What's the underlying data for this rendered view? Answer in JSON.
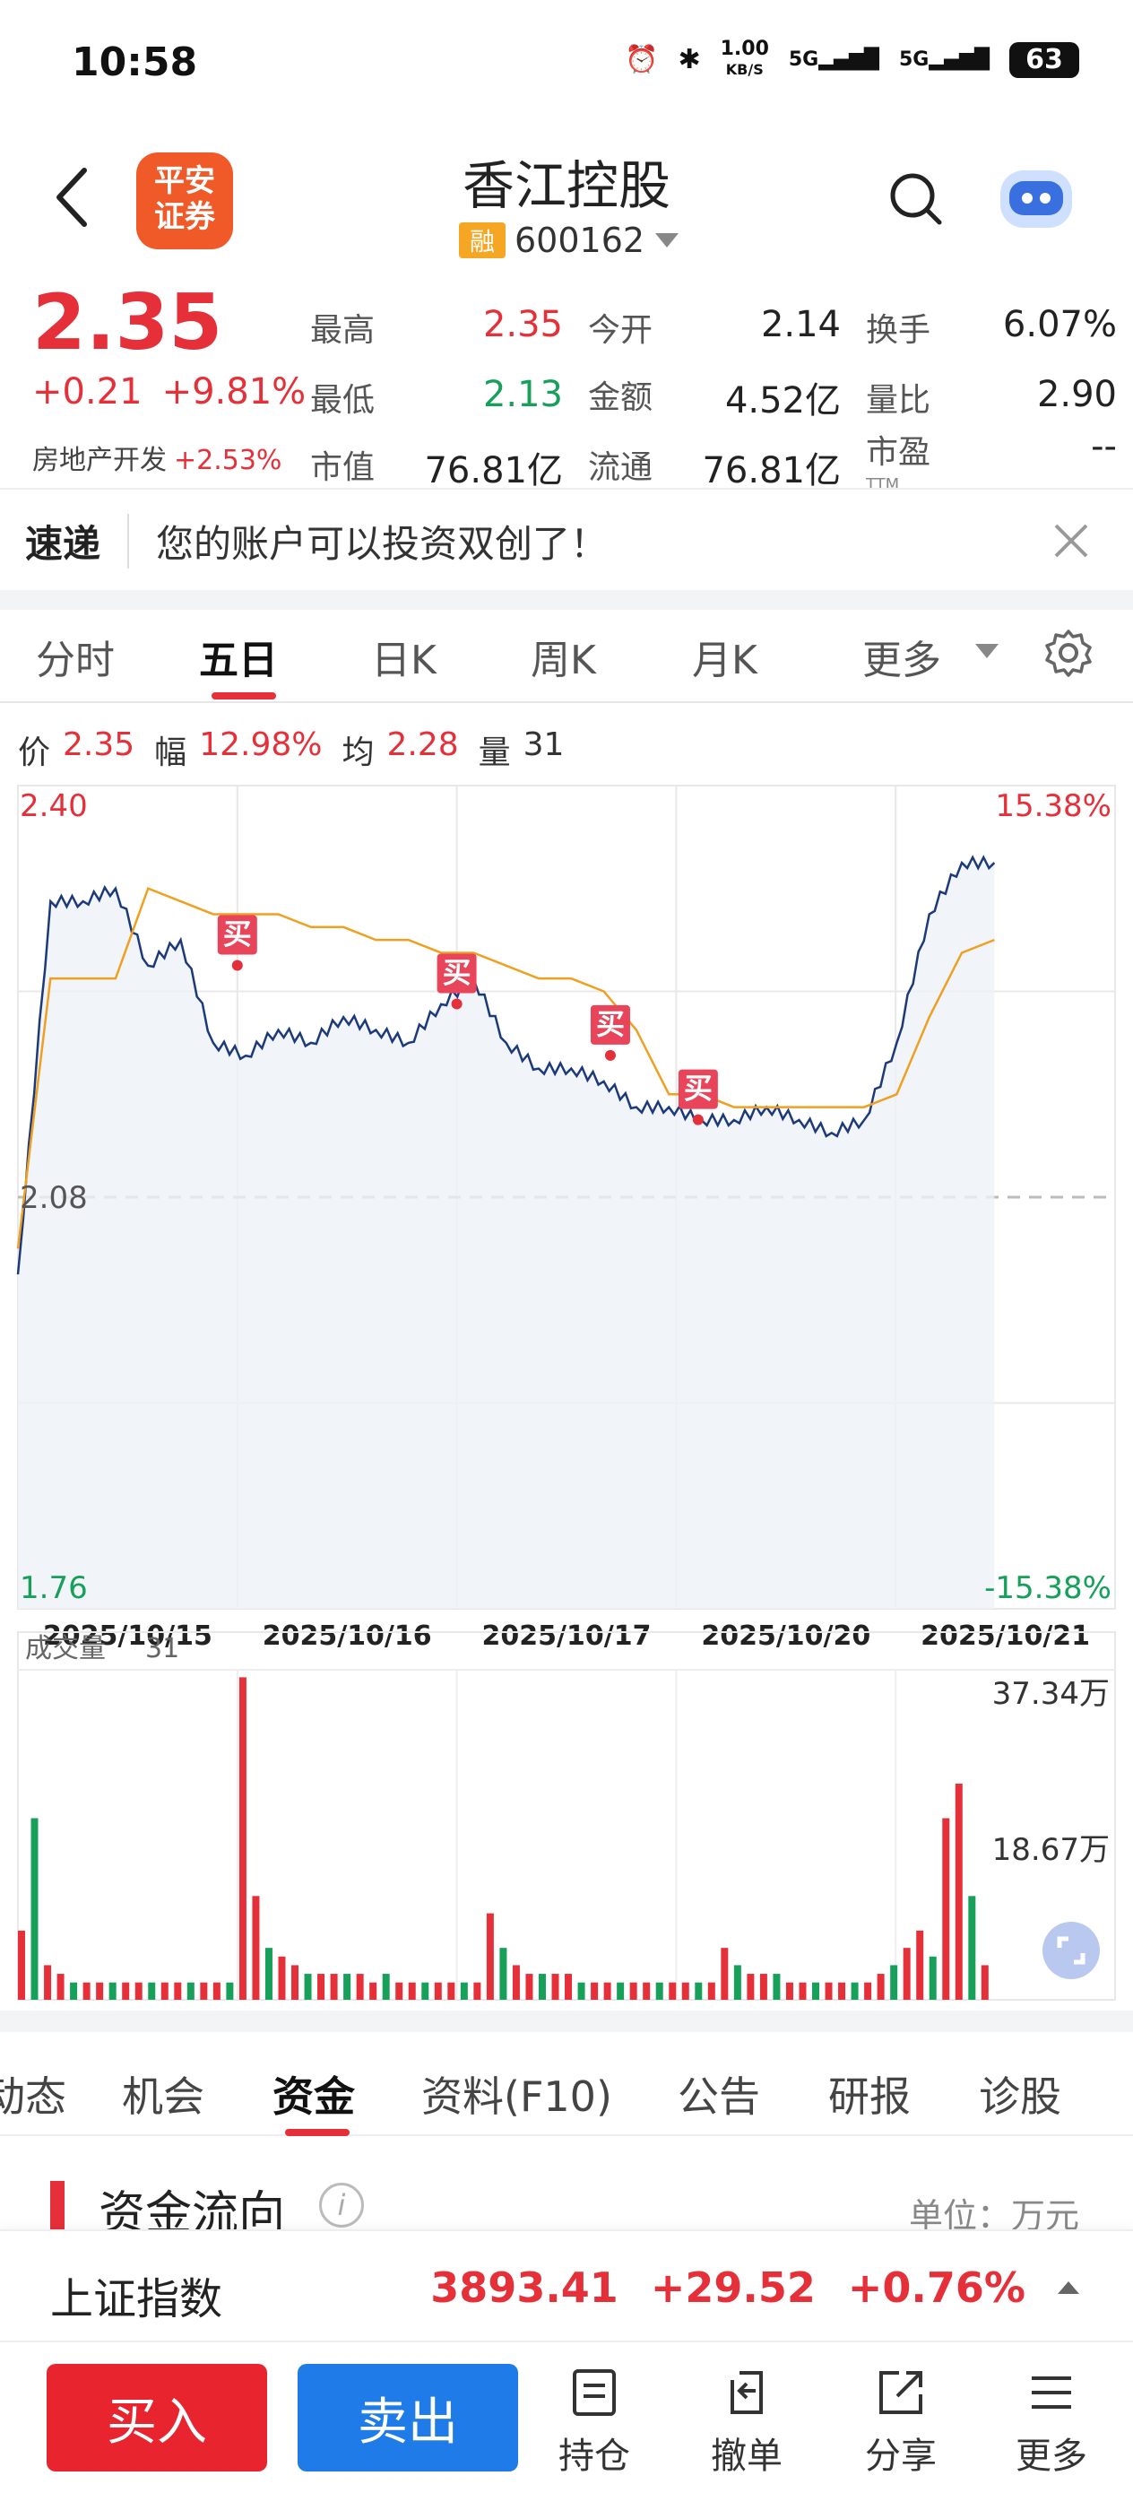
{
  "status_bar": {
    "time": "10:58",
    "speed": "1.00",
    "speed_unit": "KB/S",
    "net1": "5G",
    "net2": "5G",
    "battery": "63"
  },
  "header": {
    "logo_line1": "平安",
    "logo_line2": "证券",
    "stock_name": "香江控股",
    "margin_tag": "融",
    "stock_code": "600162"
  },
  "quote": {
    "price": "2.35",
    "change": "+0.21",
    "change_pct": "+9.81%",
    "sector": "房地产开发",
    "sector_pct": "+2.53%",
    "rows": [
      [
        {
          "label": "最高",
          "value": "2.35",
          "color": "red"
        },
        {
          "label": "今开",
          "value": "2.14",
          "color": "black"
        },
        {
          "label": "换手",
          "value": "6.07%",
          "color": "black"
        }
      ],
      [
        {
          "label": "最低",
          "value": "2.13",
          "color": "green"
        },
        {
          "label": "金额",
          "value": "4.52亿",
          "color": "black"
        },
        {
          "label": "量比",
          "value": "2.90",
          "color": "black"
        }
      ],
      [
        {
          "label": "市值",
          "value": "76.81亿",
          "color": "black"
        },
        {
          "label": "流通",
          "value": "76.81亿",
          "color": "black"
        },
        {
          "label": "市盈",
          "value": "--",
          "color": "black",
          "sup": "TTM"
        }
      ]
    ]
  },
  "notice": {
    "tag": "速递",
    "text": "您的账户可以投资双创了！"
  },
  "period_tabs": [
    "分时",
    "五日",
    "日K",
    "周K",
    "月K",
    "更多"
  ],
  "active_period": 1,
  "chart_info": {
    "price_label": "价",
    "price": "2.35",
    "amp_label": "幅",
    "amp": "12.98%",
    "avg_label": "均",
    "avg": "2.28",
    "vol_label": "量",
    "vol": "31"
  },
  "chart_data": {
    "type": "line",
    "x": [
      "2025/10/15",
      "2025/10/16",
      "2025/10/17",
      "2025/10/20",
      "2025/10/21"
    ],
    "ylim": [
      1.76,
      2.4
    ],
    "y_left_ticks": [
      "2.40",
      "2.08",
      "1.76"
    ],
    "y_right_ticks": [
      "15.38%",
      "-15.38%"
    ],
    "prev_close": 2.08,
    "series": [
      {
        "values": [
          2.02,
          2.31,
          2.31,
          2.32,
          2.26,
          2.28,
          2.2,
          2.19,
          2.21,
          2.2,
          2.22,
          2.21,
          2.2,
          2.23,
          2.25,
          2.2,
          2.18,
          2.18,
          2.17,
          2.15,
          2.15,
          2.14,
          2.14,
          2.15,
          2.14,
          2.13,
          2.14,
          2.2,
          2.3,
          2.34,
          2.34
        ]
      },
      {
        "values": [
          2.04,
          2.25,
          2.25,
          2.25,
          2.32,
          2.31,
          2.3,
          2.3,
          2.3,
          2.29,
          2.29,
          2.28,
          2.28,
          2.27,
          2.27,
          2.26,
          2.25,
          2.25,
          2.24,
          2.21,
          2.16,
          2.16,
          2.15,
          2.15,
          2.15,
          2.15,
          2.15,
          2.16,
          2.22,
          2.27,
          2.28
        ]
      }
    ],
    "buy_markers": [
      {
        "label": "买",
        "x": 1.0,
        "y": 2.27
      },
      {
        "label": "买",
        "x": 2.0,
        "y": 2.24
      },
      {
        "label": "买",
        "x": 2.7,
        "y": 2.2
      },
      {
        "label": "买",
        "x": 3.1,
        "y": 2.15
      }
    ],
    "volume": {
      "title": "成交量",
      "last": "31",
      "ticks": [
        "37.34万",
        "18.67万"
      ],
      "ymax": 37.34,
      "bars": [
        8,
        21,
        4,
        3,
        2,
        2,
        2,
        2,
        2,
        2,
        2,
        2,
        2,
        2,
        2,
        2,
        2,
        37.3,
        12,
        6,
        5,
        4,
        3,
        3,
        3,
        3,
        3,
        2,
        3,
        2,
        2,
        2,
        2,
        2,
        2,
        2,
        10,
        6,
        4,
        3,
        3,
        3,
        3,
        2,
        2,
        2,
        2,
        2,
        2,
        2,
        2,
        2,
        2,
        2,
        6,
        4,
        3,
        3,
        3,
        2,
        2,
        2,
        2,
        2,
        2,
        2,
        3,
        4,
        6,
        8,
        5,
        21,
        25,
        12,
        4
      ]
    }
  },
  "info_tabs": [
    "动态",
    "机会",
    "资金",
    "资料(F10)",
    "公告",
    "研报",
    "诊股"
  ],
  "active_info_tab": 2,
  "flow": {
    "title": "资金流向",
    "unit": "单位：万元"
  },
  "index": {
    "name": "上证指数",
    "value": "3893.41",
    "change": "+29.52",
    "pct": "+0.76%"
  },
  "bottom": {
    "buy": "买入",
    "sell": "卖出",
    "hold": "持仓",
    "cancel": "撤单",
    "share": "分享",
    "more": "更多"
  },
  "colors": {
    "accent": "#e5303a",
    "down": "#16a05a",
    "price_line": "#1c3a7a",
    "avg_line": "#f0a020",
    "buy_button": "#e8242e",
    "sell_button": "#1e7be8"
  }
}
